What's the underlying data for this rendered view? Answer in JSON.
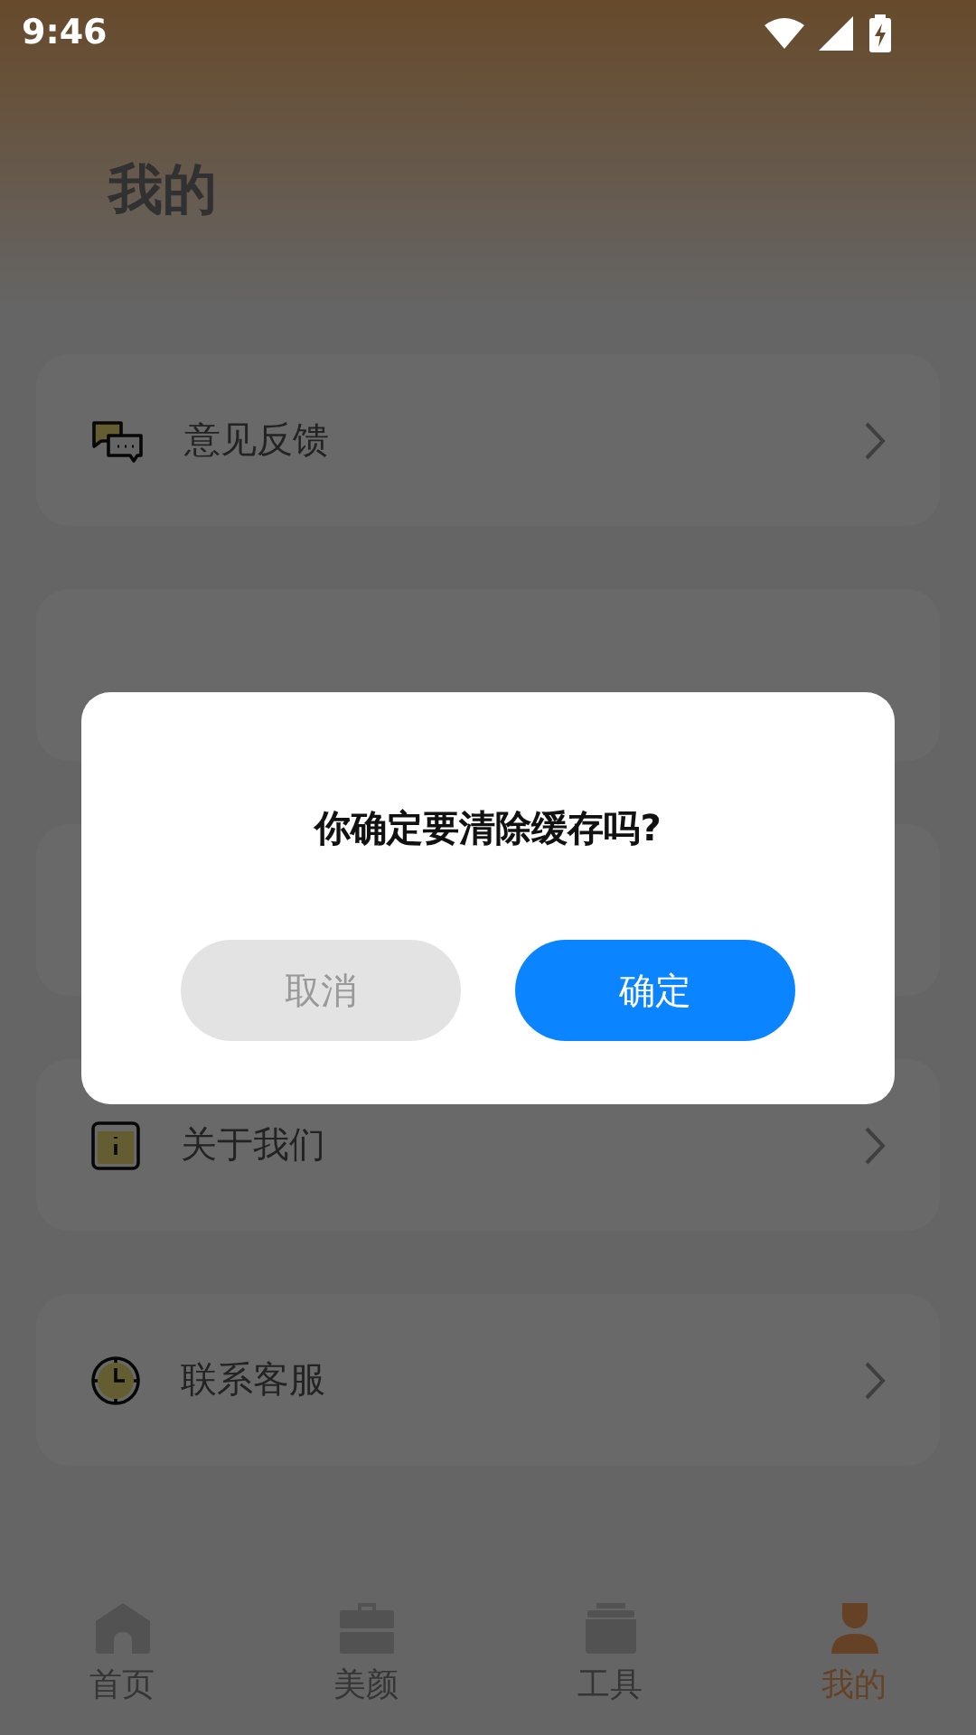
{
  "status_bar": {
    "time": "9:46"
  },
  "page": {
    "title": "我的"
  },
  "menu": [
    {
      "kind": "feedback",
      "label": "意见反馈"
    },
    {
      "kind": "blank"
    },
    {
      "kind": "blank"
    },
    {
      "kind": "about",
      "label": "关于我们"
    },
    {
      "kind": "service",
      "label": "联系客服"
    }
  ],
  "dialog": {
    "message": "你确定要清除缓存吗?",
    "buttons": [
      {
        "kind": "cancel",
        "label": "取消"
      },
      {
        "kind": "confirm",
        "label": "确定"
      }
    ]
  },
  "tabs": [
    {
      "kind": "home",
      "label": "首页",
      "selected": false
    },
    {
      "kind": "beauty",
      "label": "美颜",
      "selected": false
    },
    {
      "kind": "tools",
      "label": "工具",
      "selected": false
    },
    {
      "kind": "me",
      "label": "我的",
      "selected": true
    }
  ]
}
